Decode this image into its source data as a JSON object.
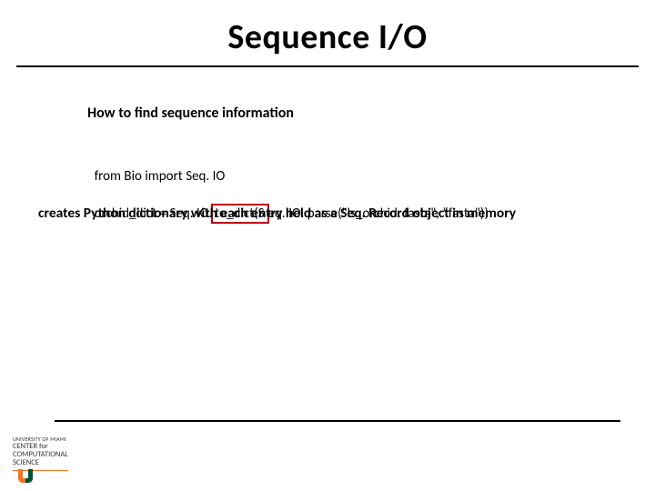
{
  "title": "Sequence I/O",
  "subhead": "How to find sequence information",
  "code": {
    "line1": "from Bio import Seq. IO",
    "line2_pre": "orchid_dict = Seq. IO.",
    "line2_box": "to_dict(S",
    "line2_post": "eq. IO. parse(\"ls_orchid. fasta\", “fasta\"))"
  },
  "description": "creates Python dictionary with each entry held as a Seq. Record object in memory",
  "footer": {
    "university": "UNIVERSITY OF MIAMI",
    "center_l1": "CENTER for",
    "center_l2": "COMPUTATIONAL",
    "center_l3": "SCIENCE"
  }
}
